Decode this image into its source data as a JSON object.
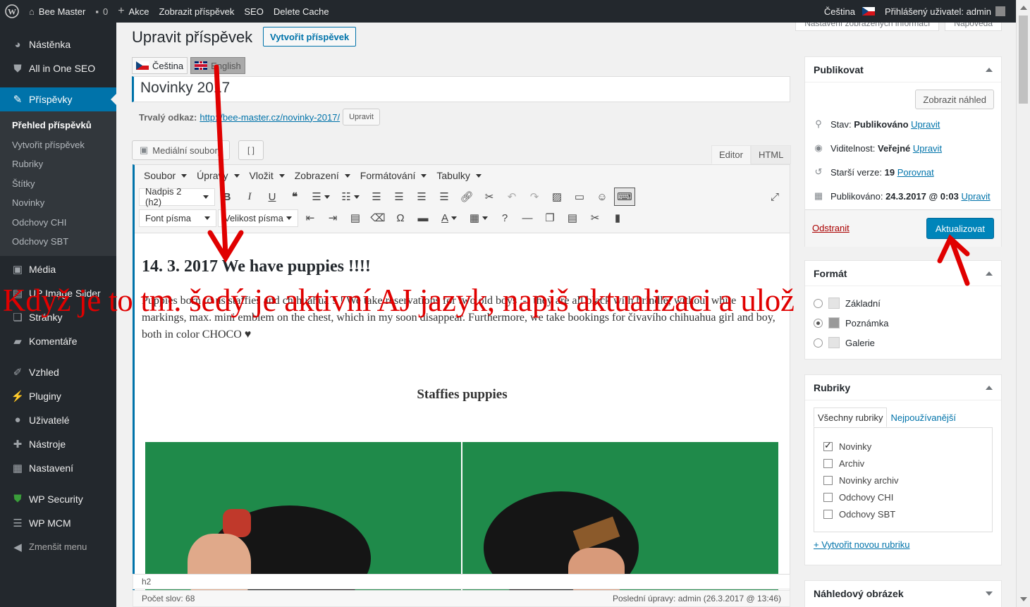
{
  "adminbar": {
    "site_name": "Bee Master",
    "comments_count": "0",
    "new_label": "Akce",
    "view_post": "Zobrazit příspěvek",
    "seo": "SEO",
    "delete_cache": "Delete Cache",
    "language": "Čeština",
    "user": "Přihlášený uživatel: admin"
  },
  "screen_tabs": [
    "Nastavení zobrazených informací",
    "Nápověda"
  ],
  "sidebar": {
    "top_items": [
      {
        "label": "Nástěnka",
        "icon": "dashboard-icon"
      },
      {
        "label": "All in One SEO",
        "icon": "shield-icon"
      }
    ],
    "active": {
      "label": "Příspěvky",
      "icon": "pin-icon"
    },
    "submenu": [
      "Přehled příspěvků",
      "Vytvořit příspěvek",
      "Rubriky",
      "Štítky",
      "Novinky",
      "Odchovy CHI",
      "Odchovy SBT"
    ],
    "items": [
      {
        "label": "Média",
        "icon": "media-icon"
      },
      {
        "label": "UP Image Slider",
        "icon": "slider-icon"
      },
      {
        "label": "Stránky",
        "icon": "pages-icon"
      },
      {
        "label": "Komentáře",
        "icon": "comment-icon"
      }
    ],
    "items2": [
      {
        "label": "Vzhled",
        "icon": "brush-icon"
      },
      {
        "label": "Pluginy",
        "icon": "plugin-icon"
      },
      {
        "label": "Uživatelé",
        "icon": "user-icon"
      },
      {
        "label": "Nástroje",
        "icon": "wrench-icon"
      },
      {
        "label": "Nastavení",
        "icon": "settings-icon"
      }
    ],
    "items3": [
      {
        "label": "WP Security",
        "icon": "security-shield-icon"
      },
      {
        "label": "WP MCM",
        "icon": "list-icon"
      }
    ],
    "collapse": "Zmenšit menu"
  },
  "page": {
    "title": "Upravit příspěvek",
    "add_new": "Vytvořit příspěvek",
    "lang_tabs": [
      "Čeština",
      "English"
    ],
    "post_title": "Novinky 2017",
    "permalink_label": "Trvalý odkaz:",
    "permalink_url": "http://bee-master.cz/novinky-2017/",
    "permalink_edit": "Upravit",
    "media_button": "Mediální soubory",
    "editor_tabs": [
      "Editor",
      "HTML"
    ]
  },
  "editor": {
    "menubar": [
      "Soubor",
      "Úpravy",
      "Vložit",
      "Zobrazení",
      "Formátování",
      "Tabulky"
    ],
    "format_select": "Nadpis 2 (h2)",
    "font_select": "Font písma",
    "size_select": "Velikost písma",
    "heading": "14. 3. 2017 We have puppies !!!!",
    "paragraph": "Puppies born to us staffies and chihuahua´s ! We take reservations for two old boys ;-) they are all black with brindle, without white markings, max. mini emblem on the chest, which in my soon disappear. Furthermore, we take bookings for čivavího chihuahua girl and boy, both in color CHOCO ♥",
    "subheading": "Staffies puppies",
    "path": "h2",
    "word_count": "Počet slov: 68",
    "last_edit": "Poslední úpravy: admin (26.3.2017 @ 13:46)"
  },
  "publish": {
    "title": "Publikovat",
    "preview": "Zobrazit náhled",
    "status_label": "Stav:",
    "status_value": "Publikováno",
    "visibility_label": "Viditelnost:",
    "visibility_value": "Veřejné",
    "revisions_label": "Starší verze:",
    "revisions_value": "19",
    "revisions_link": "Porovnat",
    "published_label": "Publikováno:",
    "published_value": "24.3.2017 @ 0:03",
    "edit": "Upravit",
    "delete": "Odstranit",
    "update": "Aktualizovat"
  },
  "format_box": {
    "title": "Formát",
    "options": [
      {
        "label": "Základní",
        "checked": false
      },
      {
        "label": "Poznámka",
        "checked": true
      },
      {
        "label": "Galerie",
        "checked": false
      }
    ]
  },
  "categories": {
    "title": "Rubriky",
    "tabs": [
      "Všechny rubriky",
      "Nejpoužívanější"
    ],
    "items": [
      {
        "label": "Novinky",
        "checked": true
      },
      {
        "label": "Archiv",
        "checked": false
      },
      {
        "label": "Novinky archiv",
        "checked": false
      },
      {
        "label": "Odchovy CHI",
        "checked": false
      },
      {
        "label": "Odchovy SBT",
        "checked": false
      }
    ],
    "add_new": "+ Vytvořit novou rubriku"
  },
  "featured": {
    "title": "Náhledový obrázek"
  },
  "annotation": {
    "text": "Když je to tm. šedý je aktivní AJ jazyk, napiš aktualizaci a ulož",
    "color": "#e00000"
  }
}
